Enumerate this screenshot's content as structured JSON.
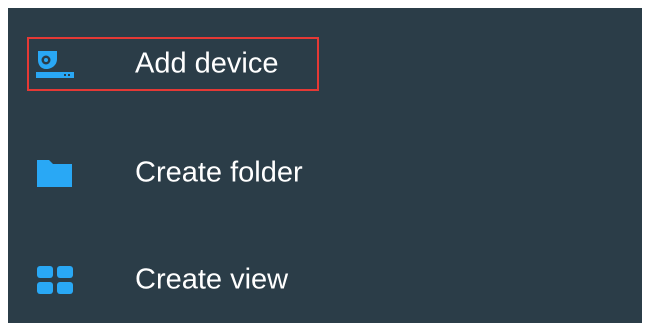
{
  "menu": {
    "items": [
      {
        "label": "Add device",
        "icon": "camera-device-icon",
        "highlighted": true
      },
      {
        "label": "Create folder",
        "icon": "folder-icon",
        "highlighted": false
      },
      {
        "label": "Create view",
        "icon": "grid-view-icon",
        "highlighted": false
      }
    ]
  },
  "colors": {
    "background": "#2b3d48",
    "accent": "#29a8f5",
    "highlight_border": "#e53935",
    "text": "#ffffff"
  }
}
